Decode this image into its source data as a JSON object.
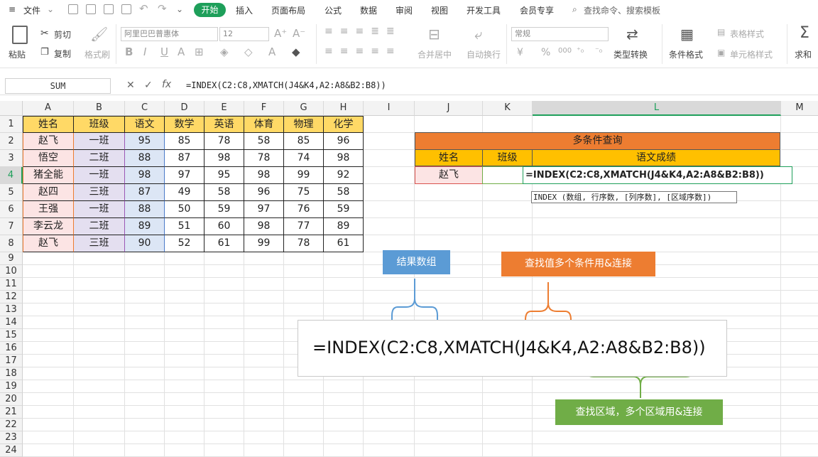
{
  "menu": {
    "file": "文件",
    "tabs": [
      "开始",
      "插入",
      "页面布局",
      "公式",
      "数据",
      "审阅",
      "视图",
      "开发工具",
      "会员专享"
    ],
    "search": "查找命令、搜索模板"
  },
  "ribbon": {
    "paste": "粘贴",
    "cut": "剪切",
    "copy": "复制",
    "format_painter": "格式刷",
    "font_name": "阿里巴巴普惠体",
    "font_size": "12",
    "merge_center": "合并居中",
    "wrap": "自动换行",
    "number_format": "常规",
    "type_convert": "类型转换",
    "cond_format": "条件格式",
    "table_style": "表格样式",
    "cell_style": "单元格样式",
    "sum": "求和",
    "percent": "%",
    "thousands": "000"
  },
  "formula_bar": {
    "name_box": "SUM",
    "fx": "fx",
    "formula": "=INDEX(C2:C8,XMATCH(J4&K4,A2:A8&B2:B8))"
  },
  "columns": [
    "A",
    "B",
    "C",
    "D",
    "E",
    "F",
    "G",
    "H",
    "I",
    "J",
    "K",
    "L",
    "M"
  ],
  "rows": [
    "1",
    "2",
    "3",
    "4",
    "5",
    "6",
    "7",
    "8",
    "9",
    "10",
    "11",
    "12",
    "13",
    "14",
    "15",
    "16",
    "17",
    "18",
    "19",
    "20",
    "21",
    "22",
    "23",
    "24"
  ],
  "table": {
    "headers": [
      "姓名",
      "班级",
      "语文",
      "数学",
      "英语",
      "体育",
      "物理",
      "化学"
    ],
    "data": [
      [
        "赵飞",
        "一班",
        "95",
        "85",
        "78",
        "58",
        "85",
        "96"
      ],
      [
        "悟空",
        "二班",
        "88",
        "87",
        "98",
        "78",
        "74",
        "98"
      ],
      [
        "猪全能",
        "一班",
        "98",
        "97",
        "95",
        "98",
        "99",
        "92"
      ],
      [
        "赵四",
        "三班",
        "87",
        "49",
        "58",
        "96",
        "75",
        "58"
      ],
      [
        "王强",
        "一班",
        "88",
        "50",
        "59",
        "97",
        "76",
        "59"
      ],
      [
        "李云龙",
        "二班",
        "89",
        "51",
        "60",
        "98",
        "77",
        "89"
      ],
      [
        "赵飞",
        "三班",
        "90",
        "52",
        "61",
        "99",
        "78",
        "61"
      ]
    ]
  },
  "query": {
    "title": "多条件查询",
    "h_name": "姓名",
    "h_class": "班级",
    "h_score": "语文成绩",
    "v_name": "赵飞",
    "v_class": "",
    "v_formula": "=INDEX(C2:C8,XMATCH(J4&K4,A2:A8&B2:B8))",
    "tooltip": "INDEX (数组, 行序数, [列序数], [区域序数])"
  },
  "annotations": {
    "result_array": "结果数组",
    "lookup_value": "查找值多个条件用&连接",
    "lookup_range": "查找区域，多个区域用&连接",
    "big_formula": "=INDEX(C2:C8,XMATCH(J4&K4,A2:A8&B2:B8))"
  },
  "colors": {
    "accent_green": "#1e9f5a",
    "orange_header": "#ed7d31",
    "yellow_header": "#ffc000",
    "callout_blue": "#5b9bd5",
    "callout_orange": "#ed7d31",
    "callout_green": "#70ad47"
  }
}
